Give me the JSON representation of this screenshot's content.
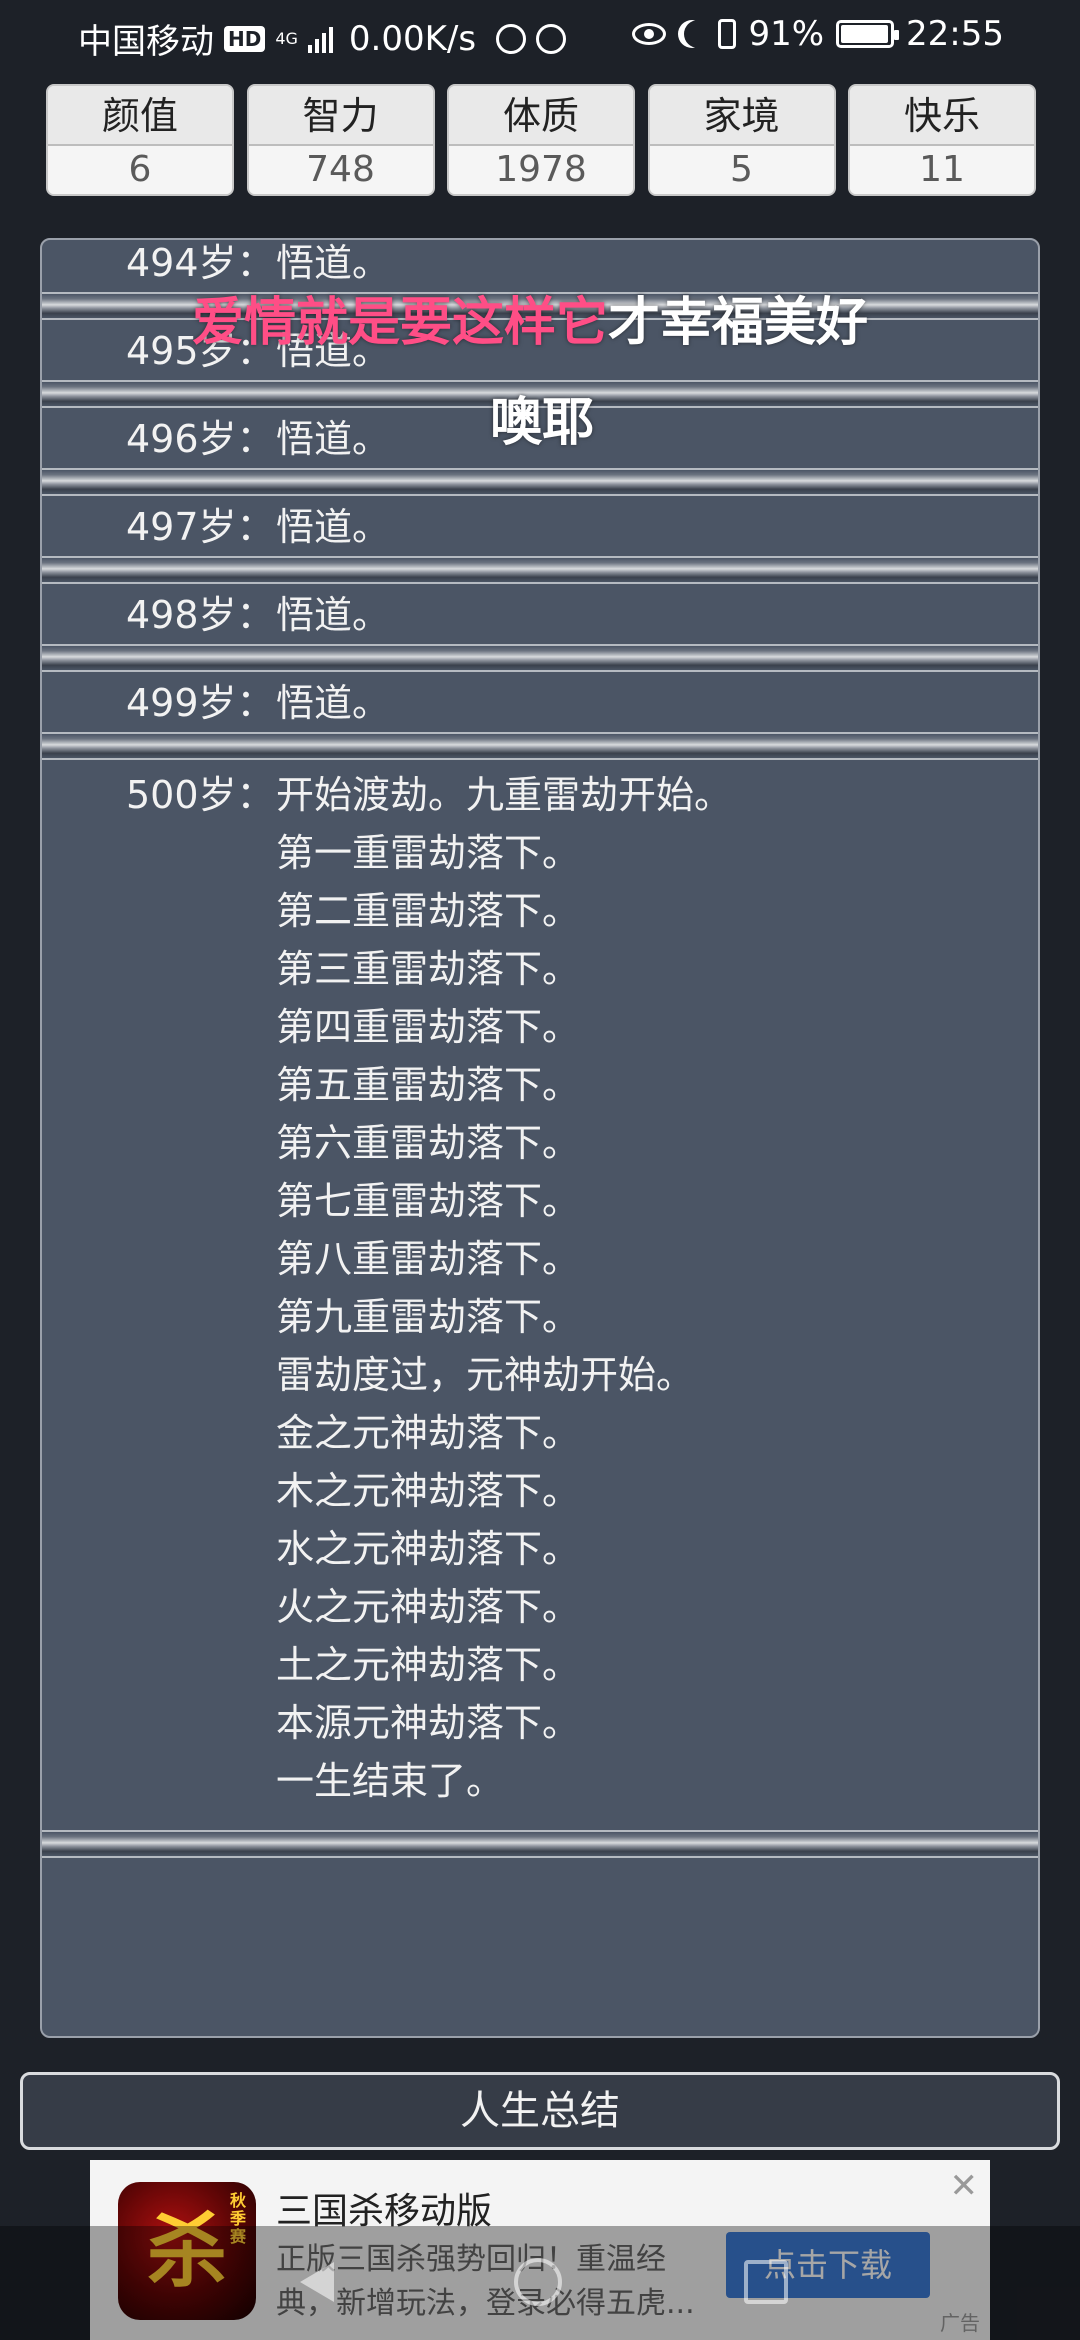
{
  "status_bar": {
    "carrier": "中国移动",
    "hd_badge": "HD",
    "network": "4G",
    "speed": "0.00K/s",
    "battery": "91%",
    "time": "22:55"
  },
  "stats": [
    {
      "label": "颜值",
      "value": "6"
    },
    {
      "label": "智力",
      "value": "748"
    },
    {
      "label": "体质",
      "value": "1978"
    },
    {
      "label": "家境",
      "value": "5"
    },
    {
      "label": "快乐",
      "value": "11"
    }
  ],
  "log": [
    {
      "age": "494岁：",
      "events": [
        "悟道。"
      ]
    },
    {
      "age": "495岁：",
      "events": [
        "悟道。"
      ]
    },
    {
      "age": "496岁：",
      "events": [
        "悟道。"
      ]
    },
    {
      "age": "497岁：",
      "events": [
        "悟道。"
      ]
    },
    {
      "age": "498岁：",
      "events": [
        "悟道。"
      ]
    },
    {
      "age": "499岁：",
      "events": [
        "悟道。"
      ]
    },
    {
      "age": "500岁：",
      "events": [
        "开始渡劫。九重雷劫开始。",
        "第一重雷劫落下。",
        "第二重雷劫落下。",
        "第三重雷劫落下。",
        "第四重雷劫落下。",
        "第五重雷劫落下。",
        "第六重雷劫落下。",
        "第七重雷劫落下。",
        "第八重雷劫落下。",
        "第九重雷劫落下。",
        "雷劫度过，元神劫开始。",
        "金之元神劫落下。",
        "木之元神劫落下。",
        "水之元神劫落下。",
        "火之元神劫落下。",
        "土之元神劫落下。",
        "本源元神劫落下。",
        "一生结束了。"
      ]
    }
  ],
  "overlay": {
    "line1_pink": "爱情就是要这样它",
    "line1_white": "才幸福美好",
    "line2": "噢耶",
    "pink_color": "#ff4e86"
  },
  "summary_button": "人生总结",
  "ad": {
    "title": "三国杀移动版",
    "description": "正版三国杀强势回归！重温经典，新增玩法，登录必得五虎...",
    "cta": "点击下载",
    "tag": "广告",
    "icon_text": "杀",
    "icon_small_text": "秋季赛"
  }
}
